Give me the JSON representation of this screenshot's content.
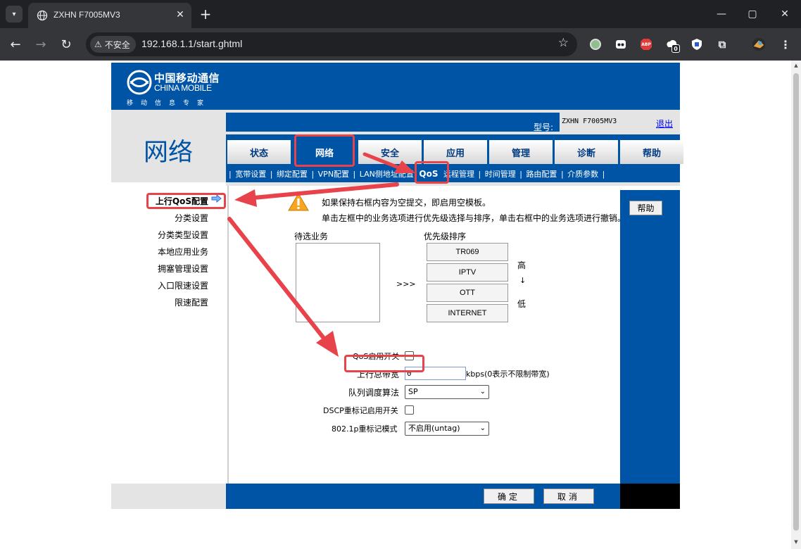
{
  "browser": {
    "tab_title": "ZXHN F7005MV3",
    "insecure_label": "不安全",
    "url": "192.168.1.1/start.ghtml",
    "ext_badge_count": "0",
    "abp_label": "ABP"
  },
  "header": {
    "logo_cn": "中国移动通信",
    "logo_en": "CHINA MOBILE",
    "logo_slogan": "移动信息专家",
    "section_title": "网络",
    "model_label": "型号:",
    "model_value": "ZXHN F7005MV3",
    "logout": "退出"
  },
  "main_tabs": [
    {
      "label": "状态"
    },
    {
      "label": "网络"
    },
    {
      "label": "安全"
    },
    {
      "label": "应用"
    },
    {
      "label": "管理"
    },
    {
      "label": "诊断"
    },
    {
      "label": "帮助"
    }
  ],
  "sub_tabs": [
    {
      "label": "宽带设置"
    },
    {
      "label": "绑定配置"
    },
    {
      "label": "VPN配置"
    },
    {
      "label": "LAN侧地址配置"
    },
    {
      "label": "QoS"
    },
    {
      "label": "远程管理"
    },
    {
      "label": "时间管理"
    },
    {
      "label": "路由配置"
    },
    {
      "label": "介质参数"
    }
  ],
  "sidebar": {
    "items": [
      {
        "label": "上行QoS配置"
      },
      {
        "label": "分类设置"
      },
      {
        "label": "分类类型设置"
      },
      {
        "label": "本地应用业务"
      },
      {
        "label": "拥塞管理设置"
      },
      {
        "label": "入口限速设置"
      },
      {
        "label": "限速配置"
      }
    ]
  },
  "content": {
    "warn_line1": "如果保持右框内容为空提交，即启用空模板。",
    "warn_line2": "单击左框中的业务选项进行优先级选择与排序，单击右框中的业务选项进行撤销。",
    "pending_label": "待选业务",
    "move_glyph": ">>>",
    "priority_label": "优先级排序",
    "priority_items": [
      "TR069",
      "IPTV",
      "OTT",
      "INTERNET"
    ],
    "priority_high": "高",
    "priority_arrow": "↓",
    "priority_low": "低",
    "qos_switch_label": "QoS启用开关",
    "bandwidth_label": "上行总带宽",
    "bandwidth_value": "0",
    "bandwidth_unit": "kbps(0表示不限制带宽)",
    "queue_algo_label": "队列调度算法",
    "queue_algo_value": "SP",
    "dscp_label": "DSCP重标记启用开关",
    "dot1p_label": "802.1p重标记模式",
    "dot1p_value": "不启用(untag)",
    "help_button": "帮助",
    "confirm_button": "确定",
    "cancel_button": "取消"
  },
  "colors": {
    "router_blue": "#0054a6",
    "annotation_red": "#e8434a",
    "panel_gray": "#e4e4e4"
  }
}
